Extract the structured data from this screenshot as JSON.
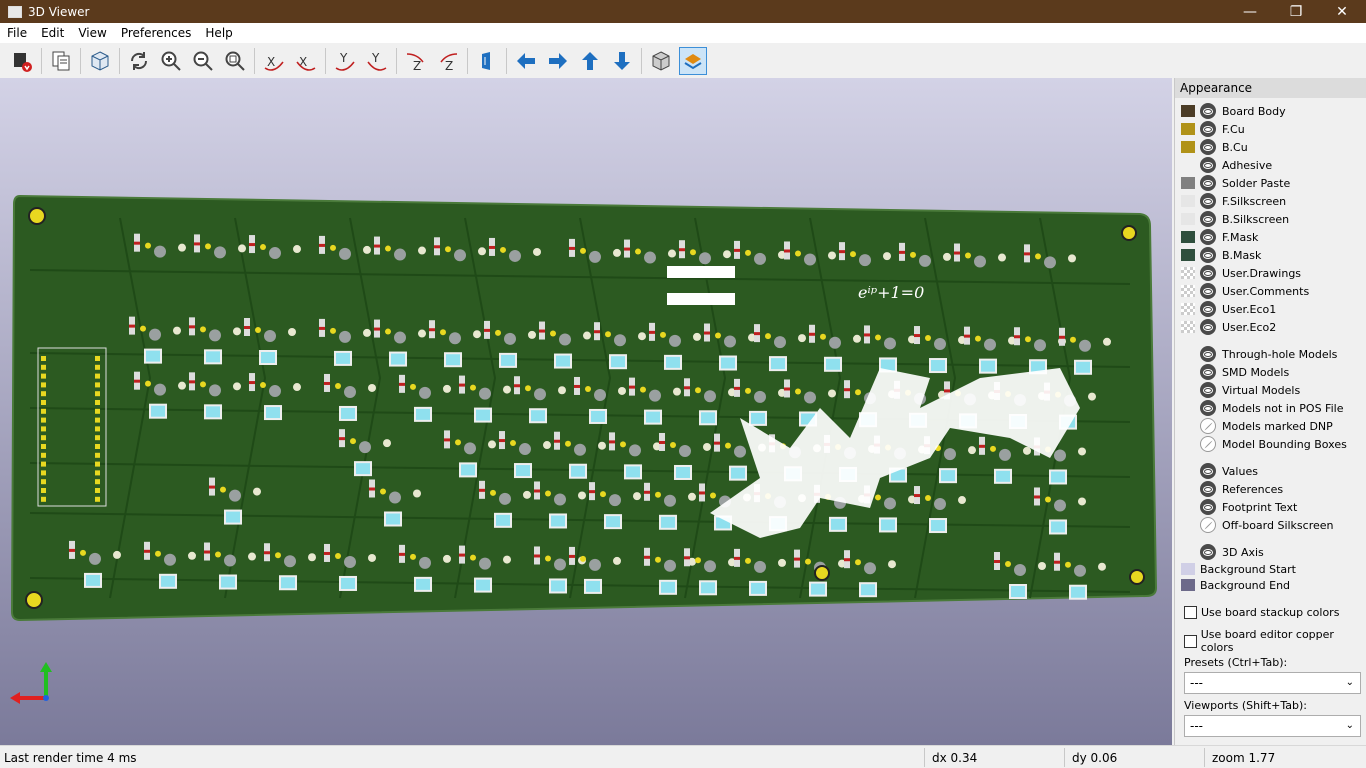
{
  "window": {
    "title": "3D Viewer",
    "minimize": "—",
    "restore": "❐",
    "close": "✕"
  },
  "menu": [
    "File",
    "Edit",
    "View",
    "Preferences",
    "Help"
  ],
  "toolbar": {
    "icons": [
      "render-icon",
      "copy-icon",
      "board-3d-icon",
      "reload-icon",
      "zoom-in-icon",
      "zoom-out-icon",
      "zoom-fit-icon",
      "rotate-x-cw-icon",
      "rotate-x-ccw-icon",
      "rotate-y-cw-icon",
      "rotate-y-ccw-icon",
      "rotate-z-cw-icon",
      "rotate-z-ccw-icon",
      "flip-board-icon",
      "arrow-left-icon",
      "arrow-right-icon",
      "arrow-up-icon",
      "arrow-down-icon",
      "ortho-icon",
      "layers-icon"
    ]
  },
  "canvas": {
    "equation": "eⁱᵖ+1=0",
    "axis_colors": {
      "x": "#e02020",
      "y": "#20c020",
      "z": "#2060e0"
    }
  },
  "appearance": {
    "title": "Appearance",
    "layers": [
      {
        "name": "Board Body",
        "color": "#4b3c26"
      },
      {
        "name": "F.Cu",
        "color": "#b09218"
      },
      {
        "name": "B.Cu",
        "color": "#b09218"
      },
      {
        "name": "Adhesive",
        "color": "#f0f0f0"
      },
      {
        "name": "Solder Paste",
        "color": "#808080"
      },
      {
        "name": "F.Silkscreen",
        "color": "#e6e6e6"
      },
      {
        "name": "B.Silkscreen",
        "color": "#e6e6e6"
      },
      {
        "name": "F.Mask",
        "color": "#2f4f3d"
      },
      {
        "name": "B.Mask",
        "color": "#2f4f3d"
      },
      {
        "name": "User.Drawings",
        "color": "checker"
      },
      {
        "name": "User.Comments",
        "color": "checker"
      },
      {
        "name": "User.Eco1",
        "color": "checker"
      },
      {
        "name": "User.Eco2",
        "color": "checker"
      }
    ],
    "models": [
      {
        "name": "Through-hole Models",
        "on": true
      },
      {
        "name": "SMD Models",
        "on": true
      },
      {
        "name": "Virtual Models",
        "on": true
      },
      {
        "name": "Models not in POS File",
        "on": true
      },
      {
        "name": "Models marked DNP",
        "on": false
      },
      {
        "name": "Model Bounding Boxes",
        "on": false
      }
    ],
    "text": [
      {
        "name": "Values",
        "on": true
      },
      {
        "name": "References",
        "on": true
      },
      {
        "name": "Footprint Text",
        "on": true
      },
      {
        "name": "Off-board Silkscreen",
        "on": false
      }
    ],
    "axis": {
      "name": "3D Axis"
    },
    "background": [
      {
        "name": "Background Start",
        "color": "#d0cfe6"
      },
      {
        "name": "Background End",
        "color": "#6d6a8a"
      }
    ],
    "checkboxes": [
      "Use board stackup colors",
      "Use board editor copper colors"
    ],
    "presets_label": "Presets (Ctrl+Tab):",
    "presets_value": "---",
    "viewports_label": "Viewports (Shift+Tab):",
    "viewports_value": "---"
  },
  "status": {
    "render_time": "Last render time 4 ms",
    "dx": "dx 0.34",
    "dy": "dy 0.06",
    "zoom": "zoom 1.77"
  }
}
